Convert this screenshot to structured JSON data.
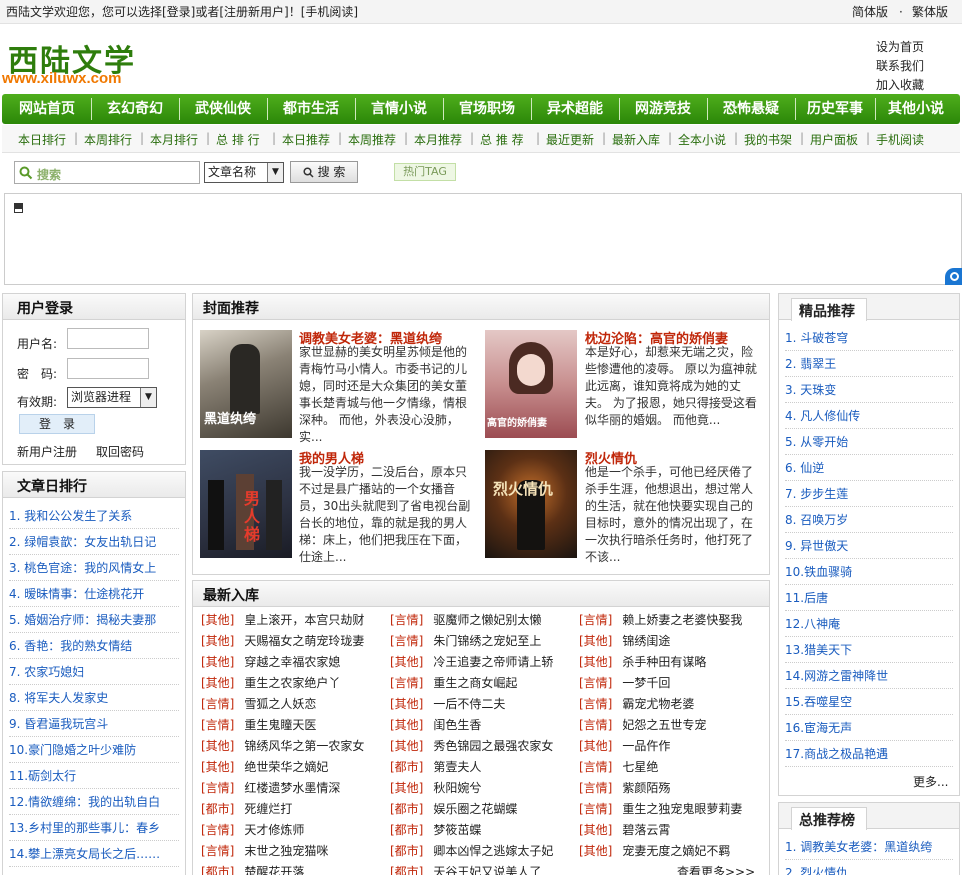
{
  "topbar": {
    "welcome": "西陆文学欢迎您，您可以选择[登录]或者[注册新用户]！[手机阅读]",
    "simplified": "简体版",
    "dot": "·",
    "traditional": "繁体版"
  },
  "logo": {
    "cn": "西陆文学",
    "url": "www.xiluwx.com"
  },
  "header_links": [
    "设为首页",
    "联系我们",
    "加入收藏"
  ],
  "nav": [
    "网站首页",
    "玄幻奇幻",
    "武侠仙侠",
    "都市生活",
    "言情小说",
    "官场职场",
    "异术超能",
    "网游竞技",
    "恐怖悬疑",
    "历史军事",
    "其他小说"
  ],
  "subnav": [
    "本日排行",
    "本周排行",
    "本月排行",
    "总 排 行",
    "本日推荐",
    "本周推荐",
    "本月推荐",
    "总 推 荐",
    "最近更新",
    "最新入库",
    "全本小说",
    "我的书架",
    "用户面板",
    "手机阅读"
  ],
  "search": {
    "placeholder": "搜索",
    "select": "文章名称",
    "button": "搜 索",
    "tag": "热门TAG"
  },
  "login": {
    "title": "用户登录",
    "username_label": "用户名:",
    "password_label": "密　码:",
    "expiry_label": "有效期:",
    "expiry_value": "浏览器进程",
    "submit": "登　录",
    "register": "新用户注册",
    "recover": "取回密码"
  },
  "daily_rank": {
    "title": "文章日排行",
    "items": [
      "1. 我和公公发生了关系",
      "2. 绿帽袁歆：女友出轨日记",
      "3. 桃色官途：我的风情女上",
      "4. 暧昧情事：仕途桃花开",
      "5. 婚姻治疗师：揭秘夫妻那",
      "6. 香艳：我的熟女情结",
      "7. 农家巧媳妇",
      "8. 将军夫人发家史",
      "9. 昏君逼我玩宫斗",
      "10.豪门隐婚之叶少难防",
      "11.砺剑太行",
      "12.情欲缠绵：我的出轨自白",
      "13.乡村里的那些事儿：春乡",
      "14.攀上漂亮女局长之后……"
    ]
  },
  "cover": {
    "title": "封面推荐",
    "books": [
      {
        "title": "调教美女老婆：黑道纨绔",
        "desc": "家世显赫的美女明星苏倾是他的青梅竹马小情人。市委书记的儿媳，同时还是大众集团的美女董事长楚青城与他一夕情缘，情根深种。 而他，外表没心没肺，实...",
        "cover_text": "黑道纨绔"
      },
      {
        "title": "枕边沦陷：高官的娇俏妻",
        "desc": "本是好心，却惹来无端之灾，险些惨遭他的凌辱。 原以为瘟神就此远离，谁知竟将成为她的丈夫。 为了报恩，她只得接受这看似华丽的婚姻。 而他竟...",
        "cover_text": "高官的娇俏妻"
      },
      {
        "title": "我的男人梯",
        "desc": "我一没学历，二没后台，原本只不过是县广播站的一个女播音员，30出头就爬到了省电视台副台长的地位，靠的就是我的男人梯：床上，他们把我压在下面，仕途上...",
        "cover_text": "男人梯"
      },
      {
        "title": "烈火情仇",
        "desc": "他是一个杀手，可他已经厌倦了杀手生涯，他想退出，想过常人的生活，就在他快要实现自己的目标时，意外的情况出现了，在一次执行暗杀任务时，他打死了不该...",
        "cover_text": "烈火情仇"
      }
    ]
  },
  "new_arrivals": {
    "title": "最新入库",
    "rows": [
      [
        [
          "[其他]",
          "皇上滚开，本宫只劫财"
        ],
        [
          "[言情]",
          "驱魔师之懒妃别太懒"
        ],
        [
          "[言情]",
          "赖上娇妻之老婆快娶我"
        ]
      ],
      [
        [
          "[其他]",
          "天赐福女之萌宠玲珑妻"
        ],
        [
          "[言情]",
          "朱门锦绣之宠妃至上"
        ],
        [
          "[其他]",
          "锦绣闺途"
        ]
      ],
      [
        [
          "[其他]",
          "穿越之幸福农家媳"
        ],
        [
          "[其他]",
          "冷王追妻之帝师请上轿"
        ],
        [
          "[其他]",
          "杀手种田有谋略"
        ]
      ],
      [
        [
          "[其他]",
          "重生之农家绝户丫"
        ],
        [
          "[言情]",
          "重生之商女崛起"
        ],
        [
          "[言情]",
          "一梦千回"
        ]
      ],
      [
        [
          "[言情]",
          "雪狐之人妖恋"
        ],
        [
          "[其他]",
          "一后不侍二夫"
        ],
        [
          "[言情]",
          "霸宠尤物老婆"
        ]
      ],
      [
        [
          "[言情]",
          "重生鬼瞳天医"
        ],
        [
          "[其他]",
          "闺色生香"
        ],
        [
          "[言情]",
          "妃怨之五世专宠"
        ]
      ],
      [
        [
          "[其他]",
          "锦绣风华之第一农家女"
        ],
        [
          "[其他]",
          "秀色锦园之最强农家女"
        ],
        [
          "[其他]",
          "一品仵作"
        ]
      ],
      [
        [
          "[其他]",
          "绝世荣华之嫡妃"
        ],
        [
          "[都市]",
          "第壹夫人"
        ],
        [
          "[言情]",
          "七星绝"
        ]
      ],
      [
        [
          "[言情]",
          "红楼遗梦水墨情深"
        ],
        [
          "[其他]",
          "秋阳婉兮"
        ],
        [
          "[言情]",
          "紫颜陌殇"
        ]
      ],
      [
        [
          "[都市]",
          "死缠烂打"
        ],
        [
          "[都市]",
          "娱乐圈之花蝴蝶"
        ],
        [
          "[言情]",
          "重生之独宠鬼眼萝莉妻"
        ]
      ],
      [
        [
          "[言情]",
          "天才修炼师"
        ],
        [
          "[都市]",
          "梦筱茁蝶"
        ],
        [
          "[其他]",
          "碧落云霄"
        ]
      ],
      [
        [
          "[言情]",
          "末世之独宠猫咪"
        ],
        [
          "[都市]",
          "卿本凶悍之逃嫁太子妃"
        ],
        [
          "[其他]",
          "宠妻无度之嫡妃不羁"
        ]
      ],
      [
        [
          "[都市]",
          "楚醒花开落"
        ],
        [
          "[都市]",
          "天谷王妃又说美人了"
        ],
        [
          "",
          "查看更多>>>"
        ]
      ]
    ]
  },
  "featured": {
    "title": "精品推荐",
    "items": [
      "1. 斗破苍穹",
      "2. 翡翠王",
      "3. 天珠变",
      "4. 凡人修仙传",
      "5. 从零开始",
      "6. 仙逆",
      "7. 步步生莲",
      "8. 召唤万岁",
      "9. 异世傲天",
      "10.铁血骤骑",
      "11.后唐",
      "12.八神庵",
      "13.猎美天下",
      "14.网游之雷神降世",
      "15.吞噬星空",
      "16.宦海无声",
      "17.商战之极品艳遇"
    ],
    "more": "更多..."
  },
  "total_rec": {
    "title": "总推荐榜",
    "items": [
      "1. 调教美女老婆：黑道纨绔",
      "2. 烈火情仇"
    ]
  }
}
